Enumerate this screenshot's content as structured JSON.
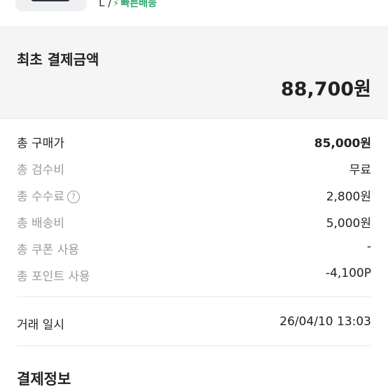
{
  "product": {
    "option_size": "L /",
    "fast_shipping": "빠른배송"
  },
  "summary": {
    "label": "최초 결제금액",
    "amount": "88,700원"
  },
  "details": [
    {
      "label": "총 구매가",
      "value": "85,000원"
    },
    {
      "label": "총 검수비",
      "value": "무료"
    },
    {
      "label": "총 수수료",
      "value": "2,800원"
    },
    {
      "label": "총 배송비",
      "value": "5,000원"
    },
    {
      "label": "총 쿠폰 사용",
      "value": "-"
    },
    {
      "label": "총 포인트 사용",
      "value": "-4,100P"
    }
  ],
  "help_glyph": "?",
  "trade": {
    "label": "거래 일시",
    "value": "26/04/10 13:03"
  },
  "payment_section_title": "결제정보",
  "colors": {
    "fast_shipping_green": "#2aa76a",
    "summary_background": "#f5f5f5",
    "muted_text": "#9a9a9a"
  },
  "icons": {
    "fast_shipping": "lightning-bolt-icon",
    "fee_help": "question-circle-icon"
  }
}
